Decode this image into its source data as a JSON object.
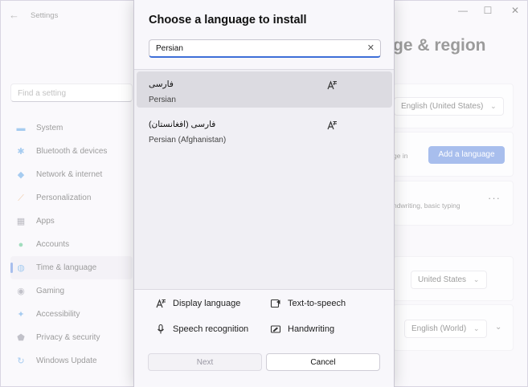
{
  "window": {
    "app_title": "Settings",
    "back_glyph": "←",
    "minimize_glyph": "—",
    "maximize_glyph": "☐",
    "close_glyph": "✕"
  },
  "sidebar": {
    "search_placeholder": "Find a setting",
    "items": [
      {
        "label": "System",
        "icon": "monitor-icon",
        "color": "#3b8ede"
      },
      {
        "label": "Bluetooth & devices",
        "icon": "bluetooth-icon",
        "color": "#3b8ede"
      },
      {
        "label": "Network & internet",
        "icon": "wifi-icon",
        "color": "#3b8ede"
      },
      {
        "label": "Personalization",
        "icon": "brush-icon",
        "color": "#e08a3a"
      },
      {
        "label": "Apps",
        "icon": "apps-icon",
        "color": "#6a6a7a"
      },
      {
        "label": "Accounts",
        "icon": "person-icon",
        "color": "#2fb36f"
      },
      {
        "label": "Time & language",
        "icon": "globe-icon",
        "color": "#3b8ede",
        "active": true
      },
      {
        "label": "Gaming",
        "icon": "gamepad-icon",
        "color": "#777788"
      },
      {
        "label": "Accessibility",
        "icon": "accessibility-icon",
        "color": "#3b8ede"
      },
      {
        "label": "Privacy & security",
        "icon": "shield-icon",
        "color": "#777788"
      },
      {
        "label": "Windows Update",
        "icon": "update-icon",
        "color": "#3b8ede"
      }
    ]
  },
  "background": {
    "page_title_fragment": "ge & region",
    "display_language_value": "English (United States)",
    "preferred_text_fragment": "ge in",
    "add_language_label": "Add a language",
    "features_fragment": "ndwriting, basic typing",
    "more_glyph": "···",
    "country_value": "United States",
    "regional_format_value": "English (World)",
    "chevron_glyph": "⌄"
  },
  "dialog": {
    "title": "Choose a language to install",
    "search_value": "Persian",
    "clear_glyph": "✕",
    "results": [
      {
        "native": "فارسی",
        "english": "Persian",
        "selected": true
      },
      {
        "native": "فارسی (افغانستان)",
        "english": "Persian (Afghanistan)",
        "selected": false
      }
    ],
    "features": {
      "display_language": "Display language",
      "text_to_speech": "Text-to-speech",
      "speech_recognition": "Speech recognition",
      "handwriting": "Handwriting"
    },
    "next_label": "Next",
    "cancel_label": "Cancel"
  },
  "colors": {
    "accent": "#3e6fd8"
  }
}
